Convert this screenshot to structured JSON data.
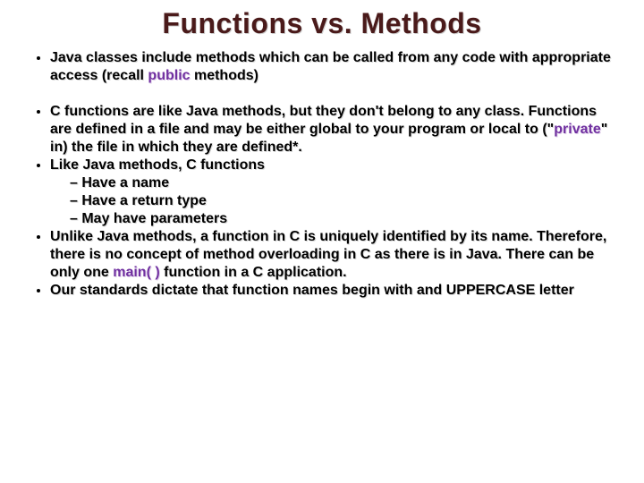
{
  "title": "Functions vs. Methods",
  "bullets": {
    "b1_a": "Java classes include methods which can be called from any code with appropriate access (recall ",
    "b1_kw": "public",
    "b1_b": " methods)",
    "b2_a": "C functions are like Java methods, but they don't belong to any class.  Functions are defined in a file and may be either global to your program or local to (\"",
    "b2_kw": "private",
    "b2_b": "\" in) the file in which they are defined*.",
    "b3": "Like Java methods, C functions",
    "b3_sub1": "Have a name",
    "b3_sub2": "Have a return type",
    "b3_sub3": "May have  parameters",
    "b4_a": "Unlike Java methods, a function in C is uniquely identified by its name.  Therefore, there is no concept of method overloading in C as there is in Java.  There can be only one ",
    "b4_kw": "main( )",
    "b4_b": " function in a C application.",
    "b5": "Our standards dictate that function names begin with and UPPERCASE letter"
  }
}
